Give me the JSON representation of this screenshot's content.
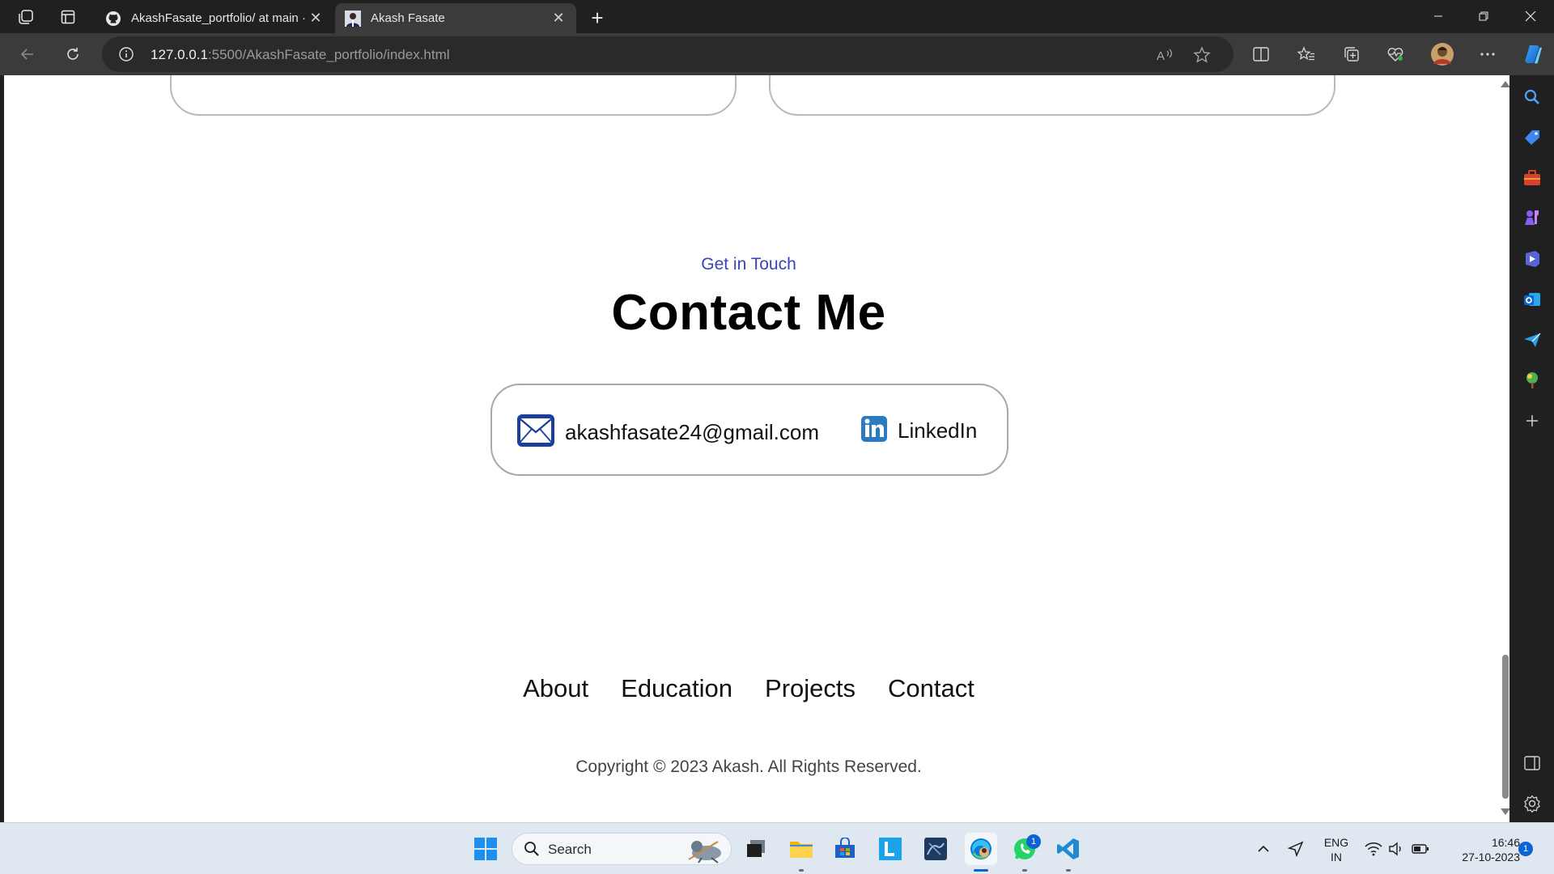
{
  "browser": {
    "tabs": [
      {
        "title": "AkashFasate_portfolio/ at main ·",
        "favicon": "github-icon",
        "active": false
      },
      {
        "title": "Akash Fasate",
        "favicon": "profile-photo-icon",
        "active": true
      }
    ],
    "address": {
      "host": "127.0.0.1",
      "path": ":5500/AkashFasate_portfolio/index.html"
    }
  },
  "page": {
    "subtitle": "Get in Touch",
    "heading": "Contact Me",
    "contact": {
      "email": "akashfasate24@gmail.com",
      "linkedin": "LinkedIn"
    },
    "footer": {
      "links": [
        "About",
        "Education",
        "Projects",
        "Contact"
      ],
      "copyright": "Copyright © 2023 Akash. All Rights Reserved."
    }
  },
  "taskbar": {
    "search_placeholder": "Search",
    "whatsapp_badge": "1",
    "language_line1": "ENG",
    "language_line2": "IN",
    "time": "16:46",
    "date": "27-10-2023",
    "notification_count": "1"
  },
  "colors": {
    "accent": "#3a44b8",
    "edge_blue": "#0a64d8"
  }
}
